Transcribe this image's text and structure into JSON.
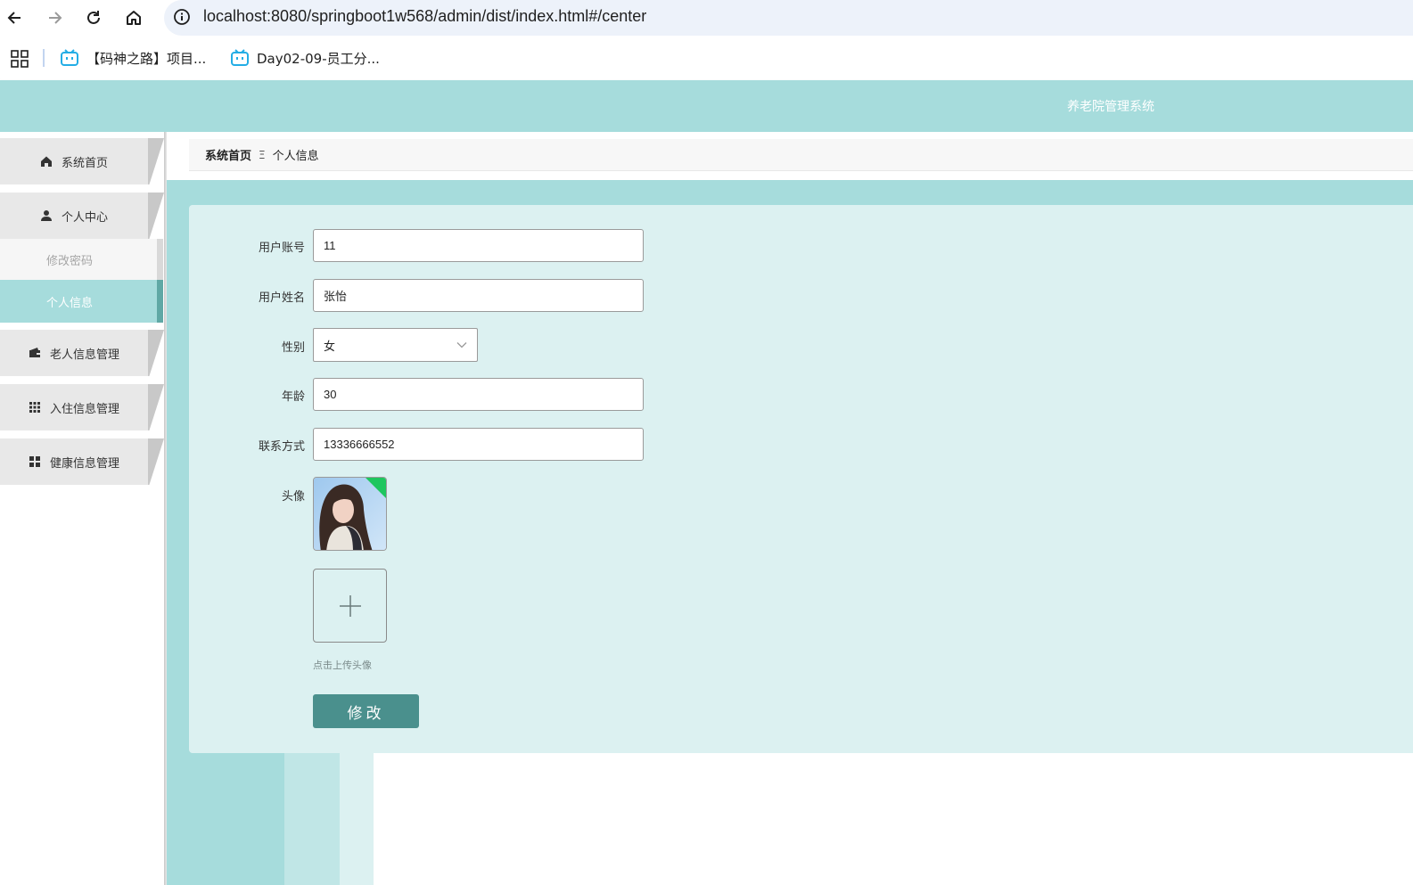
{
  "browser": {
    "url": "localhost:8080/springboot1w568/admin/dist/index.html#/center",
    "bookmarks": [
      {
        "label": "【码神之路】项目..."
      },
      {
        "label": "Day02-09-员工分..."
      }
    ]
  },
  "header": {
    "title": "养老院管理系统"
  },
  "sidebar": {
    "home": "系统首页",
    "personal_center": "个人中心",
    "submenu": {
      "change_password": "修改密码",
      "personal_info": "个人信息"
    },
    "elder_info": "老人信息管理",
    "checkin_info": "入住信息管理",
    "health_info": "健康信息管理"
  },
  "breadcrumb": {
    "home": "系统首页",
    "separator": "Ξ",
    "current": "个人信息"
  },
  "form": {
    "account_label": "用户账号",
    "account_value": "11",
    "name_label": "用户姓名",
    "name_value": "张怡",
    "gender_label": "性别",
    "gender_value": "女",
    "age_label": "年龄",
    "age_value": "30",
    "phone_label": "联系方式",
    "phone_value": "13336666552",
    "avatar_label": "头像",
    "upload_tip": "点击上传头像",
    "submit_label": "修改"
  },
  "colors": {
    "accent": "#a6dcdc",
    "panel": "#dcf1f1",
    "button": "#4a908d",
    "active_border": "#5fa8a5"
  },
  "icons": [
    "back-icon",
    "forward-icon",
    "reload-icon",
    "home-icon",
    "site-info-icon",
    "apps-icon",
    "bilibili-icon",
    "house-icon",
    "user-icon",
    "wallet-icon",
    "grid-icon",
    "squares-icon",
    "chevron-down-icon",
    "plus-icon"
  ]
}
